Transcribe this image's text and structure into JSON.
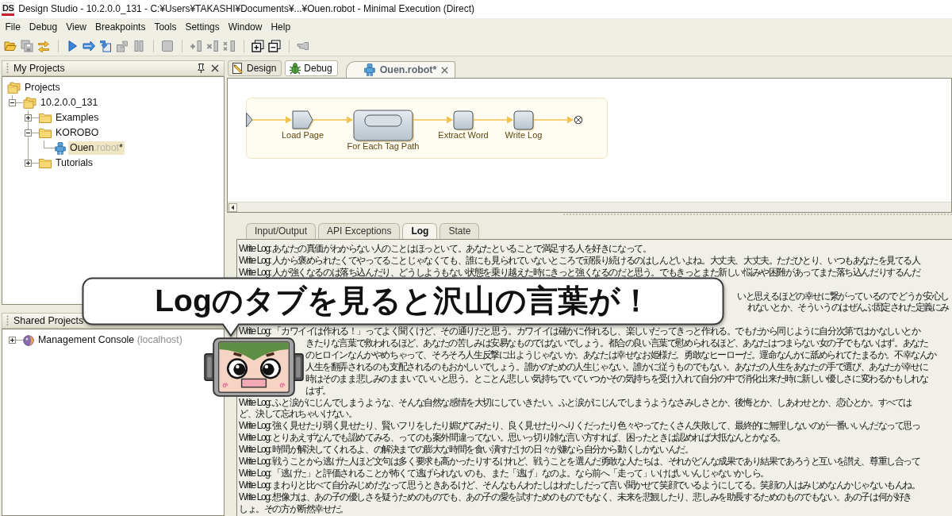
{
  "window": {
    "logo": "DS",
    "title": "Design Studio - 10.2.0.0_131 - C:¥Users¥TAKASHI¥Documents¥...¥Ouen.robot - Minimal Execution (Direct)"
  },
  "menu": [
    "File",
    "Debug",
    "View",
    "Breakpoints",
    "Tools",
    "Settings",
    "Window",
    "Help"
  ],
  "toolbar": {
    "groups": [
      [
        {
          "disabled": false
        },
        {
          "disabled": true
        },
        {
          "disabled": false
        }
      ],
      [
        {
          "disabled": false
        },
        {
          "disabled": false
        },
        {
          "disabled": false
        },
        {
          "disabled": true
        },
        {
          "disabled": true
        }
      ],
      [
        {
          "disabled": true
        }
      ],
      [
        {
          "disabled": true
        },
        {
          "disabled": true
        },
        {
          "disabled": true
        }
      ],
      [
        {
          "disabled": false
        },
        {
          "disabled": false
        }
      ],
      [
        {
          "disabled": true
        }
      ]
    ]
  },
  "projects_panel": {
    "title": "My Projects",
    "pin_and_close": true,
    "tree": [
      {
        "label": "Projects",
        "kind": "root",
        "selected": false,
        "children": [
          {
            "label": "10.2.0.0_131",
            "kind": "project",
            "expanded": true,
            "selected": false,
            "children": [
              {
                "label": "Examples",
                "kind": "folder",
                "expanded": false,
                "selected": false
              },
              {
                "label": "KOROBO",
                "kind": "folder",
                "expanded": true,
                "selected": false,
                "children": [
                  {
                    "label": "Ouen",
                    "extension": ".robot",
                    "suffix": "*",
                    "kind": "robot",
                    "selected": true
                  }
                ]
              },
              {
                "label": "Tutorials",
                "kind": "folder",
                "expanded": false,
                "selected": false
              }
            ]
          }
        ]
      }
    ]
  },
  "shared_panel": {
    "title": "Shared Projects",
    "tree": [
      {
        "label": "Management Console",
        "detail": "(localhost)",
        "kind": "server",
        "expanded": false,
        "selected": false
      }
    ]
  },
  "mode_tabs": [
    {
      "label": "Design",
      "selected": false
    },
    {
      "label": "Debug",
      "selected": true
    }
  ],
  "document_tabs": [
    {
      "label": "Ouen.robot*",
      "selected": true
    }
  ],
  "flow": {
    "steps": [
      {
        "label": "Load Page",
        "kind": "page"
      },
      {
        "label": "For Each Tag Path",
        "kind": "loop"
      },
      {
        "label": "Extract Word",
        "kind": "step"
      },
      {
        "label": "Write Log",
        "kind": "step"
      }
    ]
  },
  "bottom_tabs": [
    {
      "label": "Input/Output",
      "selected": false
    },
    {
      "label": "API Exceptions",
      "selected": false
    },
    {
      "label": "Log",
      "selected": true
    },
    {
      "label": "State",
      "selected": false
    }
  ],
  "log": [
    {
      "kind": "line",
      "text": "Write Log: あなたの真価がわからない人のことはほっといて。あなたといることで満足する人を好きになって。"
    },
    {
      "kind": "line",
      "text": "Write Log: 人から褒められたくてやってることじゃなくても、誰にも見られていないところで頑張り続けるのはしんどいよね。大丈夫、大丈夫。ただひとり、いつもあなたを見てる人"
    },
    {
      "kind": "line",
      "text": "Write Log: 人が強くなるのは落ち込んだり、どうしようもない状態を乗り越えた時にきっと強くなるのだと思う。でもきっとまた新しい悩みや困難があってまた落ち込んだりするんだ"
    },
    {
      "kind": "behind-callout",
      "text": "いと思えるほどの幸せに繋がっているので どうか安心し"
    },
    {
      "kind": "behind-callout",
      "text": "れないとか、そういうのはぜんぶ固定された定義にみ"
    },
    {
      "kind": "line",
      "text": "Write Log: 「カワイイは作れる！」ってよく聞くけど、その通りだと思う。カワイイは確かに作れるし、楽しいだってきっと作れる。でもだから同じように自分次第ではかなしいとか"
    },
    {
      "kind": "behind-mascot",
      "text": "きたりな言葉で救われるほど、あなたの苦しみは安易なものではないでしょう。都合の良い言葉で慰められるほど、あなたはつまらない女の子でもないはず。あなた"
    },
    {
      "kind": "behind-mascot",
      "text": "のヒロインなんかやめちゃって、そろそろ人生反撃に出ようじゃないか。あなたは幸せなお姫様だ。勇敢なヒーローだ。運命なんかに舐められてたまるか。不幸なんか"
    },
    {
      "kind": "behind-mascot",
      "text": "人生を翻弄されるのも支配されるのもおかしいでしょう。誰かのための人生じゃない。誰かに従うものでもない。あなたの人生をあなたの手で選び、あなたが幸せに"
    },
    {
      "kind": "behind-mascot",
      "text": "時はそのまま悲しみのままいていいと思う。とことん悲しい気持ちでいていつかその気持ちを受け入れて自分の中で消化出来た時に新しい優しさに変わるかもしれな"
    },
    {
      "kind": "behind-mascot",
      "text": "はず。"
    },
    {
      "kind": "line",
      "text": "Write Log: ふと涙がにじんでしまうような、そんな自然な感情を大切にしていきたい。ふと涙がにじんでしまうようなさみしさとか、後悔とか、しあわせとか、恋心とか。すべては"
    },
    {
      "kind": "line",
      "text": "ど、決して忘れちゃいけない。"
    },
    {
      "kind": "line",
      "text": "Write Log: 強く見せたり弱く見せたり、賢いフリをしたり媚びてみたり、良く見せたりへりくだったり色々やってたくさん失敗して、最終的に無理しないのが一番いいんだなって思っ"
    },
    {
      "kind": "line",
      "text": "Write Log: とりあえずなんでも認めてみる、ってのも案外間違ってない。思いっ切り雑な言い方すれば、困ったときは認めれば大抵なんとかなる。"
    },
    {
      "kind": "line",
      "text": "Write Log: 時間が解決してくれるよ、の解決までの膨大な時間を食い潰すだけの日々が嫌なら自分から動くしかないんだ。"
    },
    {
      "kind": "line",
      "text": "Write Log: 戦うことから逃げた人ほど文句は多く要求も高かったりするけれど、戦うことを選んだ勇敢な人たちは、それがどんな成果であり結果であろうと互いを讃え、尊重し合って"
    },
    {
      "kind": "line",
      "text": "Write Log: 「逃げた」と評価されることが怖くて逃げられないのも、また「逃げ」なのよ。なら前へ「走って」いけばいいんじゃないかしら。"
    },
    {
      "kind": "line",
      "text": "Write Log: まわりと比べて自分みじめだなって思うときあるけど、そんなもんわたしはわたしだって言い聞かせて笑顔でいるようにしてる。笑顔の人はみじめなんかじゃないもんね。"
    },
    {
      "kind": "line",
      "text": "Write Log: 想像力は、あの子の優しさを疑うためのものでも、あの子の愛を試すためのものでもなく、未来を悲観したり、悲しみを助長するためのものでもない。あの子は何が好き"
    },
    {
      "kind": "line",
      "text": "しょ。その方が断然幸せだ。"
    }
  ],
  "callout": {
    "text": "Logのタブを見ると沢山の言葉が！"
  }
}
